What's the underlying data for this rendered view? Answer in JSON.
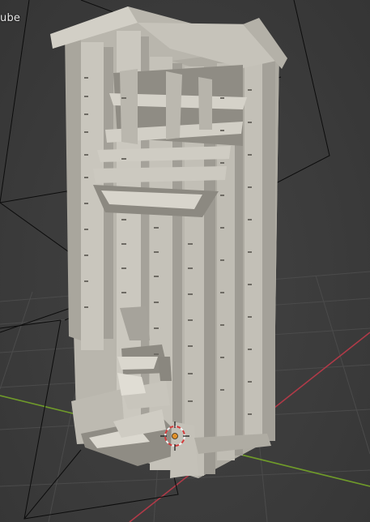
{
  "viewport": {
    "object_name": "ube",
    "colors": {
      "background": "#3b3b3b",
      "grid": "#4a4a4a",
      "x_axis": "#b03a48",
      "y_axis": "#6f9a2a",
      "model_light": "#c9c6bd",
      "model_mid": "#b3b0a6",
      "model_dark": "#8f8c84",
      "wire": "#0c0c0c",
      "cursor_red": "#d33b3b"
    }
  }
}
